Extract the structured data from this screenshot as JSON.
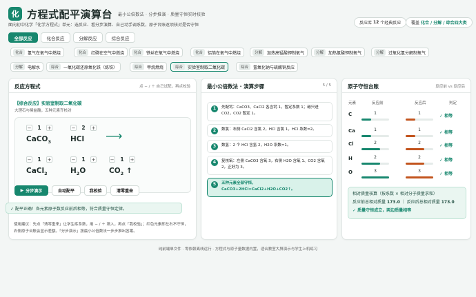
{
  "app": {
    "logo": "化",
    "title": "方程式配平演算台",
    "tagline": "最小公倍数法 · 分步推演 · 质量守恒实时校验",
    "subline": "面向初中化学「化学方程式」单元：选反应、看分步演算、自己动手调系数，原子台账逐项核对是否守恒"
  },
  "library": {
    "pre": "反应库",
    "count": "12",
    "post": "个经典反应"
  },
  "coverage": {
    "pre": "覆盖",
    "value": "化合 / 分解 / 综合四大类"
  },
  "tabs": [
    "全部反应",
    "化合反应",
    "分解反应",
    "综合反应"
  ],
  "reactions": [
    {
      "cat": "化合",
      "name": "氢气在氧气中燃烧"
    },
    {
      "cat": "化合",
      "name": "红磷在空气中燃烧"
    },
    {
      "cat": "化合",
      "name": "铁丝在氧气中燃烧"
    },
    {
      "cat": "化合",
      "name": "铝箔在氧气中燃烧"
    },
    {
      "cat": "分解",
      "name": "加热高锰酸钾制氧气"
    },
    {
      "cat": "分解",
      "name": "加热氯酸钾制氧气"
    },
    {
      "cat": "分解",
      "name": "过氧化氢分解制氧气"
    },
    {
      "cat": "分解",
      "name": "电解水"
    },
    {
      "cat": "综合",
      "name": "一氧化碳还原氧化铁（炼铁）"
    },
    {
      "cat": "综合",
      "name": "甲烷燃烧"
    },
    {
      "cat": "综合",
      "name": "实验室制取二氧化碳"
    },
    {
      "cat": "综合",
      "name": "氢氧化钠与硫酸铜反应"
    }
  ],
  "left": {
    "title": "反应方程式",
    "hint": "点 − / ＋ 自己试配，再点校验",
    "reaction_name": "【综合反应】实验室制取二氧化碳",
    "reaction_desc": "大理石与稀盐酸，五种元素齐核对",
    "reactants": [
      {
        "coef": "1",
        "f": "CaCO",
        "s": "3",
        "t": ""
      },
      {
        "coef": "2",
        "f": "HCl",
        "s": "",
        "t": ""
      }
    ],
    "products": [
      {
        "coef": "1",
        "f": "CaCl",
        "s": "2",
        "t": ""
      },
      {
        "coef": "1",
        "f": "H",
        "s": "2",
        "t": "O"
      },
      {
        "coef": "1",
        "f": "CO",
        "s": "2",
        "t": " ↑"
      }
    ],
    "arrow": "⟶",
    "minus": "−",
    "plus": "+",
    "buttons": {
      "demo": "分步演示",
      "auto": "自动配平",
      "check": "我校验",
      "reset": "清零重来"
    },
    "play": "▶",
    "result": "✓ 配平正确！各元素原子数反应前后相等，符合质量守恒定律。",
    "tip": "使用建议：先点「清零重来」让学生练系数，用 − / ＋ 填入，再点「我校验」；红色元素即左右不守恒，右侧原子台账会显示差额。「分步演示」按最小公倍数法一步步推出答案。"
  },
  "mid": {
    "title": "最小公倍数法 · 演算步骤",
    "page": "5 / 5",
    "steps": [
      {
        "n": "1",
        "t": "先配钙：CaCO3、CaCl2 各含钙 1，暂定系数 1；碳只进 CO2，CO2 暂定 1。"
      },
      {
        "n": "2",
        "t": "数氯：右侧 CaCl2 含氯 2，HCl 含氯 1，HCl 系数=2。"
      },
      {
        "n": "3",
        "t": "数氢：2 个 HCl 含氢 2，H2O 系数=1。"
      },
      {
        "n": "4",
        "t": "复核氧：左侧 CaCO3 含氧 3，右侧 H2O 含氧 1、CO2 含氧 2，正好为 3。"
      },
      {
        "n": "5",
        "t": "五种元素全部守恒，CaCO3+2HCl=CaCl2+H2O+CO2↑。"
      }
    ]
  },
  "right": {
    "title": "原子守恒台账",
    "note": "反应前 vs 反应后",
    "headers": [
      "元素",
      "反应前",
      "反应后",
      "判定"
    ],
    "rows": [
      {
        "el": "C",
        "before": "1",
        "after": "1",
        "status": "✓ 相等"
      },
      {
        "el": "Ca",
        "before": "1",
        "after": "1",
        "status": "✓ 相等"
      },
      {
        "el": "Cl",
        "before": "2",
        "after": "2",
        "status": "✓ 相等"
      },
      {
        "el": "H",
        "before": "2",
        "after": "2",
        "status": "✓ 相等"
      },
      {
        "el": "O",
        "before": "3",
        "after": "3",
        "status": "✓ 相等"
      }
    ],
    "sum1": "相对质量核算（按系数 × 相对分子质量求和）",
    "sum2pre": "反应前总相对质量",
    "sum2val": "173.0",
    "sep": "｜",
    "sum3pre": "反应后总相对质量",
    "sum3val": "173.0",
    "sum4": "✓ 质量守恒成立，两边质量相等"
  },
  "footer": "纯前端单文件 · 零依赖离线运行 · 方程式与原子量数据内置，适合教室大屏演示与学生上机练习"
}
